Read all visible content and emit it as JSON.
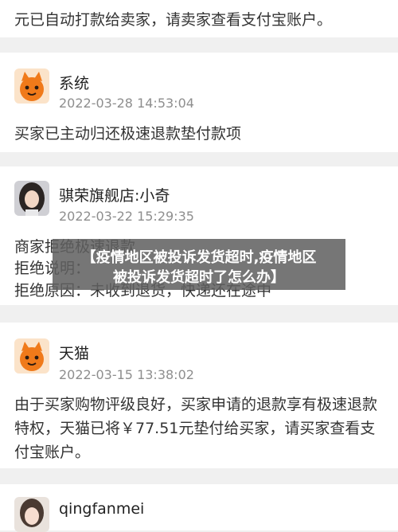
{
  "messages": [
    {
      "lines": [
        "元已自动打款给卖家，请卖家查看支付宝账户。"
      ]
    },
    {
      "name": "系统",
      "time": "2022-03-28 14:53:04",
      "lines": [
        "买家已主动归还极速退款垫付款项"
      ]
    },
    {
      "name": "骐荣旗舰店:小奇",
      "time": "2022-03-22 15:29:35",
      "lines": [
        "商家拒绝极速退款",
        "拒绝说明：",
        "拒绝原因：未收到退货，快递还在途中"
      ]
    },
    {
      "name": "天猫",
      "time": "2022-03-15 13:38:02",
      "lines": [
        "由于买家购物评级良好，买家申请的退款享有极速退款",
        "特权，天猫已将￥77.51元垫付给买家，请买家查看支",
        "付宝账户。"
      ]
    },
    {
      "name": "qingfanmei"
    }
  ],
  "overlay": {
    "line1": "【疫情地区被投诉发货超时,疫情地区",
    "line2": "被投诉发货超时了怎么办】"
  },
  "icons": {
    "tmall": "orange-cat-mascot-icon",
    "shop": "woman-portrait-icon",
    "user": "woman-portrait-icon"
  },
  "colors": {
    "background": "#f0f0f0",
    "card": "#ffffff",
    "mascot": "#f07a1a",
    "timestamp": "#8e8e8e",
    "overlay": "#5f5f5f"
  }
}
